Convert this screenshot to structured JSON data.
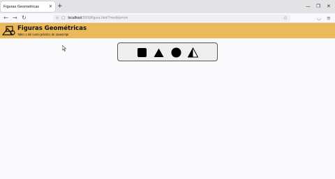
{
  "browser": {
    "tab_title": "Figuras Geometricas",
    "url_host": "localhost",
    "url_rest": ":5500/figura.html?medida=cm"
  },
  "header": {
    "title": "Figuras Geométricas",
    "subtitle": "Taller 1 del curso práctico de Javascript"
  },
  "shapes": [
    {
      "name": "Cuadrado",
      "icon": "square-icon"
    },
    {
      "name": "Triángulo",
      "icon": "triangle-icon"
    },
    {
      "name": "Círculo",
      "icon": "circle-icon"
    },
    {
      "name": "Triángulo isósceles",
      "icon": "isosceles-triangle-icon"
    }
  ],
  "colors": {
    "header_bg": "#ebb85a",
    "shape_fill": "#000000",
    "panel_bg": "#efefef"
  }
}
